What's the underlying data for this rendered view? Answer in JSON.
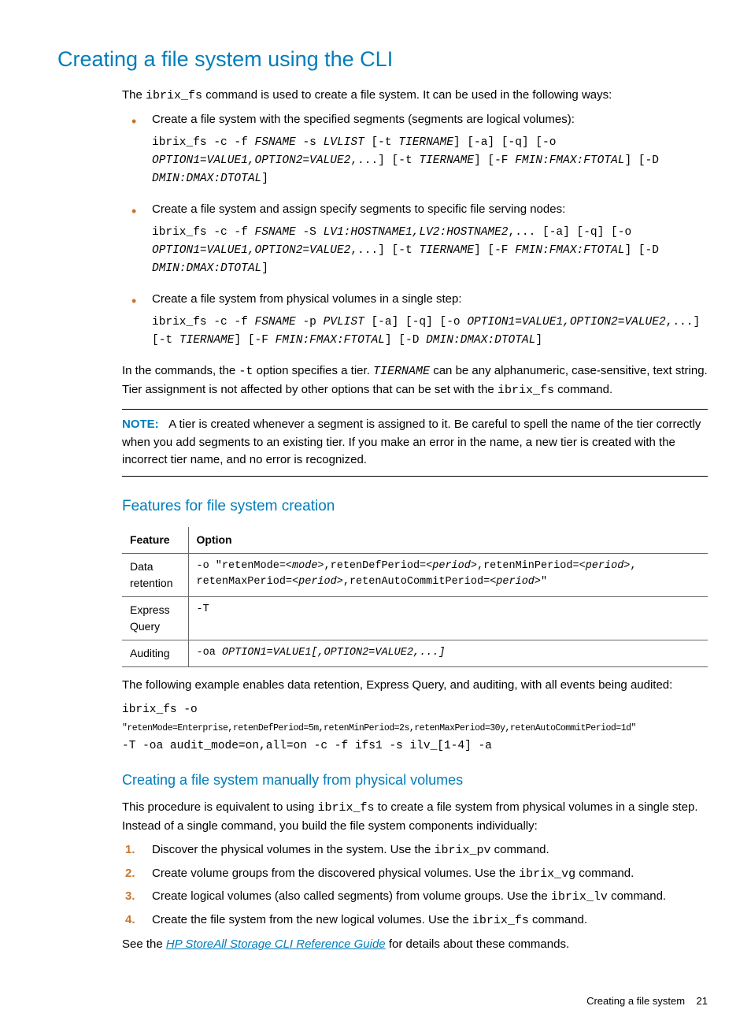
{
  "heading": "Creating a file system using the CLI",
  "intro_1": "The ",
  "intro_cmd": "ibrix_fs",
  "intro_2": " command is used to create a file system. It can be used in the following ways:",
  "bullets": [
    {
      "text": "Create a file system with the specified segments (segments are logical volumes):",
      "code": "ibrix_fs -c -f FSNAME -s LVLIST [-t TIERNAME] [-a] [-q] [-o OPTION1=VALUE1,OPTION2=VALUE2,...] [-t TIERNAME] [-F FMIN:FMAX:FTOTAL] [-D DMIN:DMAX:DTOTAL]"
    },
    {
      "text": "Create a file system and assign specify segments to specific file serving nodes:",
      "code": "ibrix_fs -c -f FSNAME -S LV1:HOSTNAME1,LV2:HOSTNAME2,... [-a] [-q] [-o OPTION1=VALUE1,OPTION2=VALUE2,...] [-t TIERNAME] [-F FMIN:FMAX:FTOTAL] [-D DMIN:DMAX:DTOTAL]"
    },
    {
      "text": "Create a file system from physical volumes in a single step:",
      "code": "ibrix_fs -c -f FSNAME -p PVLIST [-a] [-q] [-o OPTION1=VALUE1,OPTION2=VALUE2,...] [-t TIERNAME] [-F FMIN:FMAX:FTOTAL] [-D DMIN:DMAX:DTOTAL]"
    }
  ],
  "tier_para_1": "In the commands, the ",
  "tier_opt": "-t",
  "tier_para_2": " option specifies a tier. ",
  "tier_name": "TIERNAME",
  "tier_para_3": " can be any alphanumeric, case-sensitive, text string. Tier assignment is not affected by other options that can be set with the ",
  "tier_cmd": "ibrix_fs",
  "tier_para_4": " command.",
  "note_label": "NOTE:",
  "note_text": "A tier is created whenever a segment is assigned to it. Be careful to spell the name of the tier correctly when you add segments to an existing tier. If you make an error in the name, a new tier is created with the incorrect tier name, and no error is recognized.",
  "features_heading": "Features for file system creation",
  "table": {
    "h1": "Feature",
    "h2": "Option",
    "r1c1": "Data retention",
    "r1c2": "-o \"retenMode=<mode>,retenDefPeriod=<period>,retenMinPeriod=<period>, retenMaxPeriod=<period>,retenAutoCommitPeriod=<period>\"",
    "r2c1": "Express Query",
    "r2c2": "-T",
    "r3c1": "Auditing",
    "r3c2": "-oa OPTION1=VALUE1[,OPTION2=VALUE2,...]"
  },
  "example_text": "The following example enables data retention, Express Query, and auditing, with all events being audited:",
  "example_line1": "ibrix_fs -o",
  "example_line2": "\"retenMode=Enterprise,retenDefPeriod=5m,retenMinPeriod=2s,retenMaxPeriod=30y,retenAutoCommitPeriod=1d\"",
  "example_line3": "-T -oa audit_mode=on,all=on -c -f ifs1 -s ilv_[1-4] -a",
  "manual_heading": "Creating a file system manually from physical volumes",
  "manual_p1a": "This procedure is equivalent to using ",
  "manual_p1_cmd": "ibrix_fs",
  "manual_p1b": " to create a file system from physical volumes in a single step. Instead of a single command, you build the file system components individually:",
  "steps": [
    {
      "a": "Discover the physical volumes in the system. Use the ",
      "cmd": "ibrix_pv",
      "b": " command."
    },
    {
      "a": "Create volume groups from the discovered physical volumes. Use the ",
      "cmd": "ibrix_vg",
      "b": " command."
    },
    {
      "a": "Create logical volumes (also called segments) from volume groups. Use the ",
      "cmd": "ibrix_lv",
      "b": " command."
    },
    {
      "a": "Create the file system from the new logical volumes. Use the ",
      "cmd": "ibrix_fs",
      "b": " command."
    }
  ],
  "see_a": "See the ",
  "see_link": "HP StoreAll Storage CLI Reference Guide",
  "see_b": " for details about these commands.",
  "footer_text": "Creating a file system",
  "footer_page": "21"
}
